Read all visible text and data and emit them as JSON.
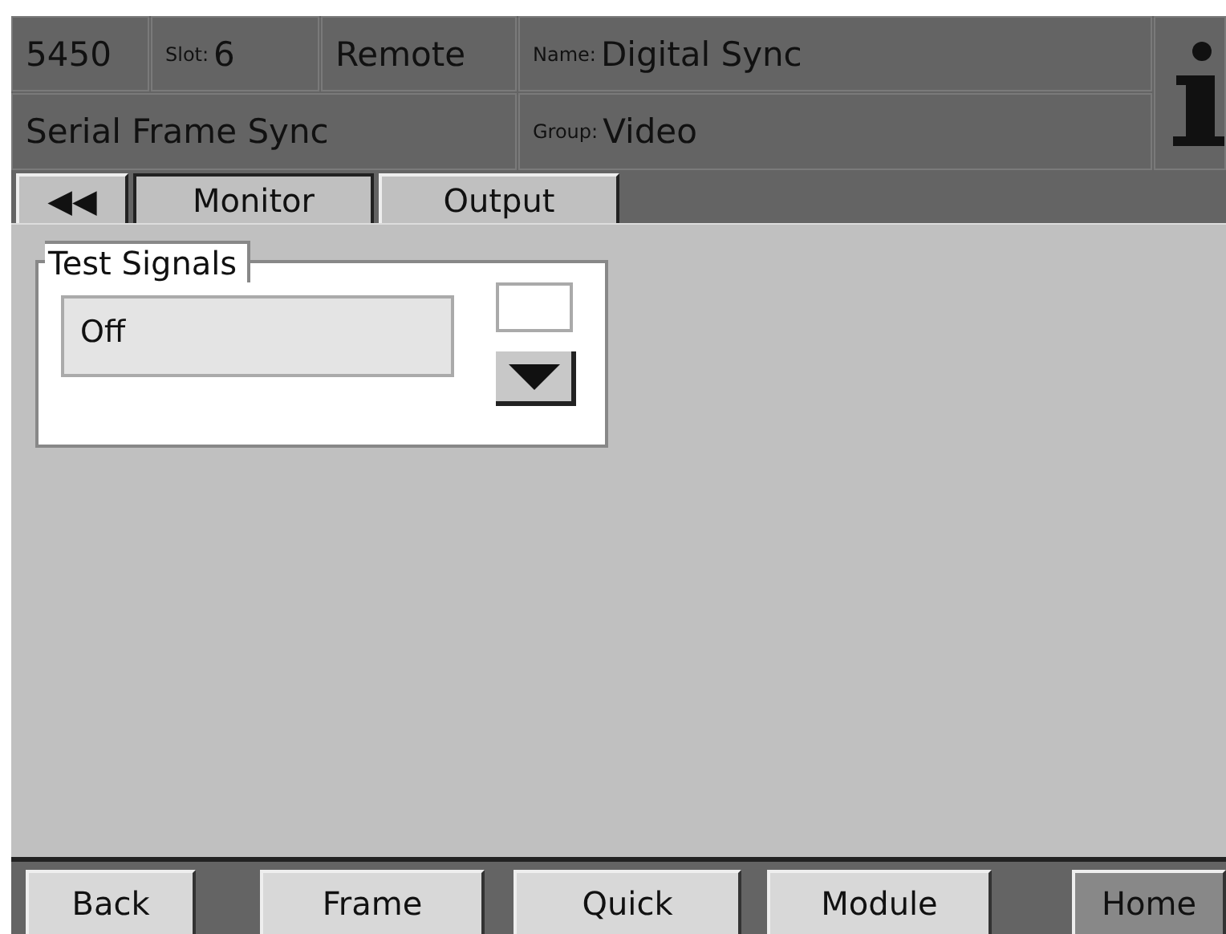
{
  "header": {
    "model": "5450",
    "slot_label": "Slot:",
    "slot": "6",
    "mode": "Remote",
    "name_label": "Name:",
    "name": "Digital Sync",
    "product": "Serial Frame Sync",
    "group_label": "Group:",
    "group": "Video"
  },
  "back_tab": "◀◀",
  "tabs": [
    {
      "label": "Monitor",
      "selected": true
    },
    {
      "label": "Output",
      "selected": false
    }
  ],
  "panel": {
    "title": "Test Signals",
    "value": "Off"
  },
  "nav_buttons": [
    {
      "label": "Back",
      "selected": false
    },
    {
      "label": "Frame",
      "selected": false
    },
    {
      "label": "Quick",
      "selected": false
    },
    {
      "label": "Module",
      "selected": false
    },
    {
      "label": "Home",
      "selected": true
    }
  ]
}
